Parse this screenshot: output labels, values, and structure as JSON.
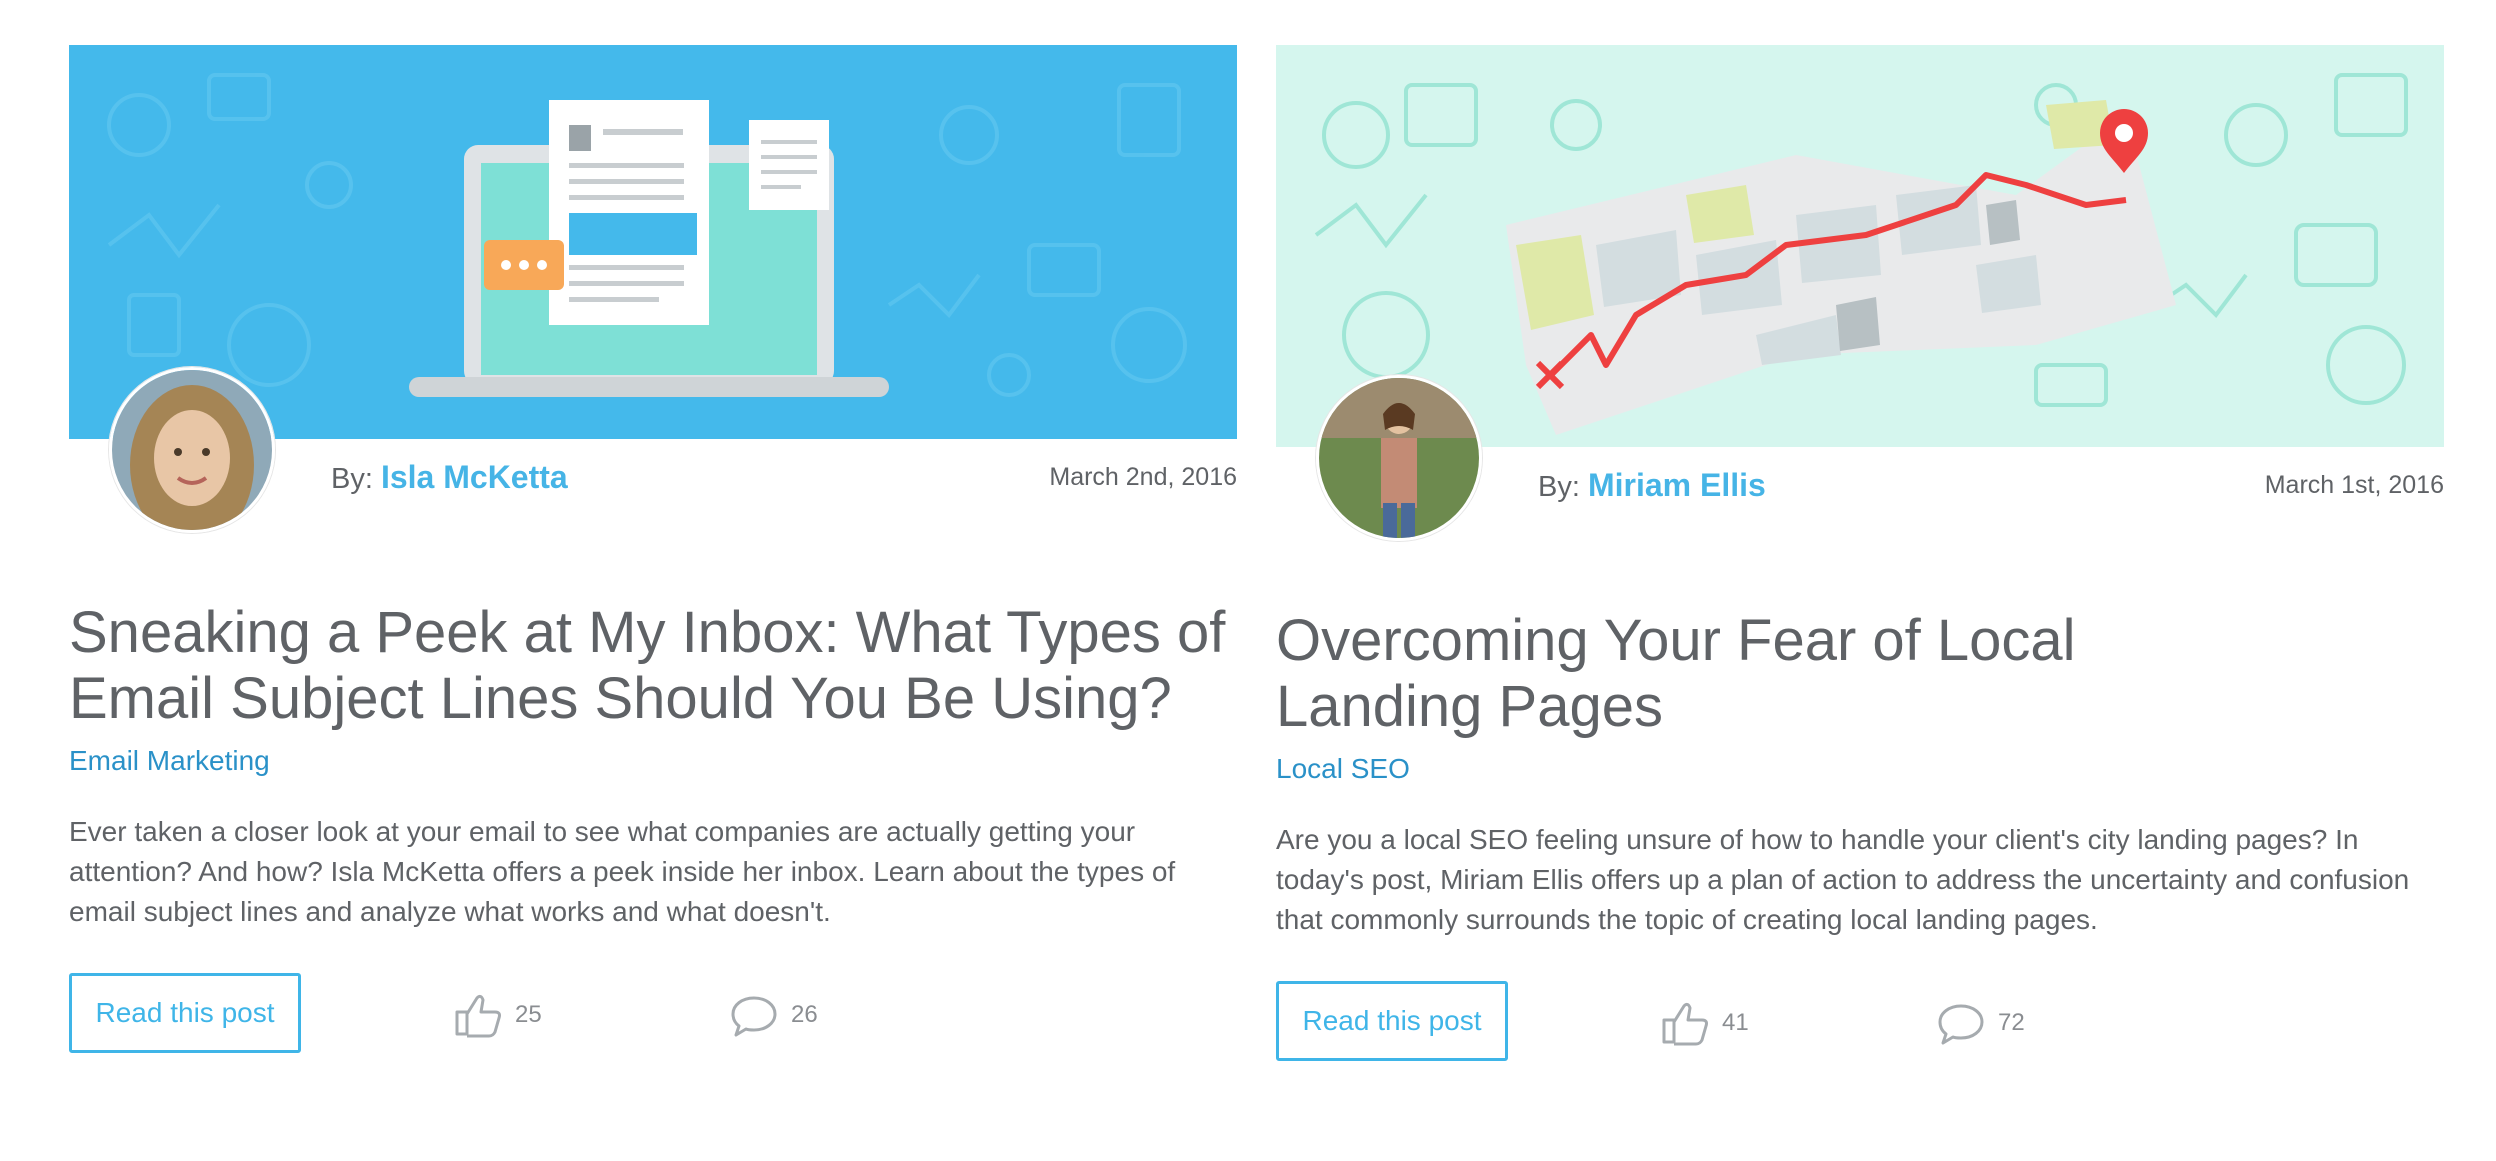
{
  "colors": {
    "accent": "#44b9eb",
    "link": "#2a91c8",
    "text": "#5f6266",
    "banner_blue": "#44b9eb",
    "banner_mint": "#d5f6ee"
  },
  "posts": [
    {
      "by_label": "By:",
      "author": "Isla McKetta",
      "date": "March 2nd, 2016",
      "title": "Sneaking a Peek at My Inbox: What Types of Email Subject Lines Should You Be Using?",
      "category": "Email Marketing",
      "excerpt": "Ever taken a closer look at your email to see what companies are actually getting your attention? And how? Isla McKetta offers a peek inside her inbox. Learn about the types of email subject lines and analyze what works and what doesn't.",
      "button_label": "Read this post",
      "likes": "25",
      "comments": "26",
      "icons": {
        "banner": "laptop-email-illustration",
        "like": "thumbs-up-icon",
        "comment": "speech-bubble-icon"
      }
    },
    {
      "by_label": "By:",
      "author": "Miriam Ellis",
      "date": "March 1st, 2016",
      "title": "Overcoming Your Fear of Local Landing Pages",
      "category": "Local SEO",
      "excerpt": "Are you a local SEO feeling unsure of how to handle your client's city landing pages? In today's post, Miriam Ellis offers up a plan of action to address the uncertainty and confusion that commonly surrounds the topic of creating local landing pages.",
      "button_label": "Read this post",
      "likes": "41",
      "comments": "72",
      "icons": {
        "banner": "map-route-illustration",
        "like": "thumbs-up-icon",
        "comment": "speech-bubble-icon"
      }
    }
  ]
}
